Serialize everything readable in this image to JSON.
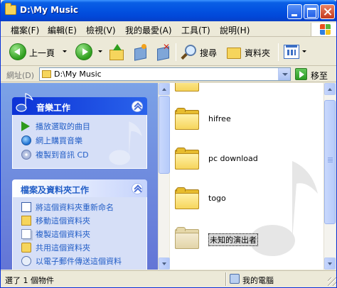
{
  "window": {
    "title": "D:\\My Music"
  },
  "menu": [
    "檔案(F)",
    "編輯(E)",
    "檢視(V)",
    "我的最愛(A)",
    "工具(T)",
    "說明(H)"
  ],
  "toolbar": {
    "back_label": "上一頁",
    "search_label": "搜尋",
    "folders_label": "資料夾"
  },
  "address": {
    "label": "網址(D)",
    "value": "D:\\My Music",
    "go_label": "移至"
  },
  "music_tasks": {
    "title": "音樂工作",
    "items": [
      "播放選取的曲目",
      "網上購買音樂",
      "複製到音訊 CD"
    ]
  },
  "file_tasks": {
    "title": "檔案及資料夾工作",
    "items": [
      "將這個資料夾重新命名",
      "移動這個資料夾",
      "複製這個資料夾",
      "共用這個資料夾",
      "以電子郵件傳送這個資料"
    ]
  },
  "files": [
    {
      "name": "hifree",
      "selected": false
    },
    {
      "name": "pc download",
      "selected": false
    },
    {
      "name": "togo",
      "selected": false
    },
    {
      "name": "未知的演出者",
      "selected": true
    }
  ],
  "status": {
    "left": "選了 1 個物件",
    "right": "我的電腦"
  }
}
